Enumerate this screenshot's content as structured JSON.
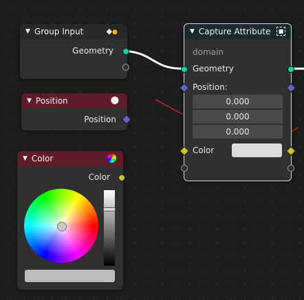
{
  "group_input": {
    "title": "Group Input",
    "geometry_label": "Geometry"
  },
  "position_node": {
    "title": "Position",
    "output_label": "Position"
  },
  "color_node": {
    "title": "Color",
    "output_label": "Color"
  },
  "capture_attribute": {
    "title": "Capture Attribute",
    "domain_label": "domain",
    "geometry_label": "Geometry",
    "position_label": "Position:",
    "values": [
      "0.000",
      "0.000",
      "0.000"
    ],
    "color_label": "Color"
  },
  "colors": {
    "geometry_socket": "#00d6a3",
    "vector_socket": "#6363c7",
    "color_socket": "#c7c729",
    "input_header": "#282828",
    "attribute_header": "#5e1d28",
    "capture_header": "#1a2a2e"
  }
}
